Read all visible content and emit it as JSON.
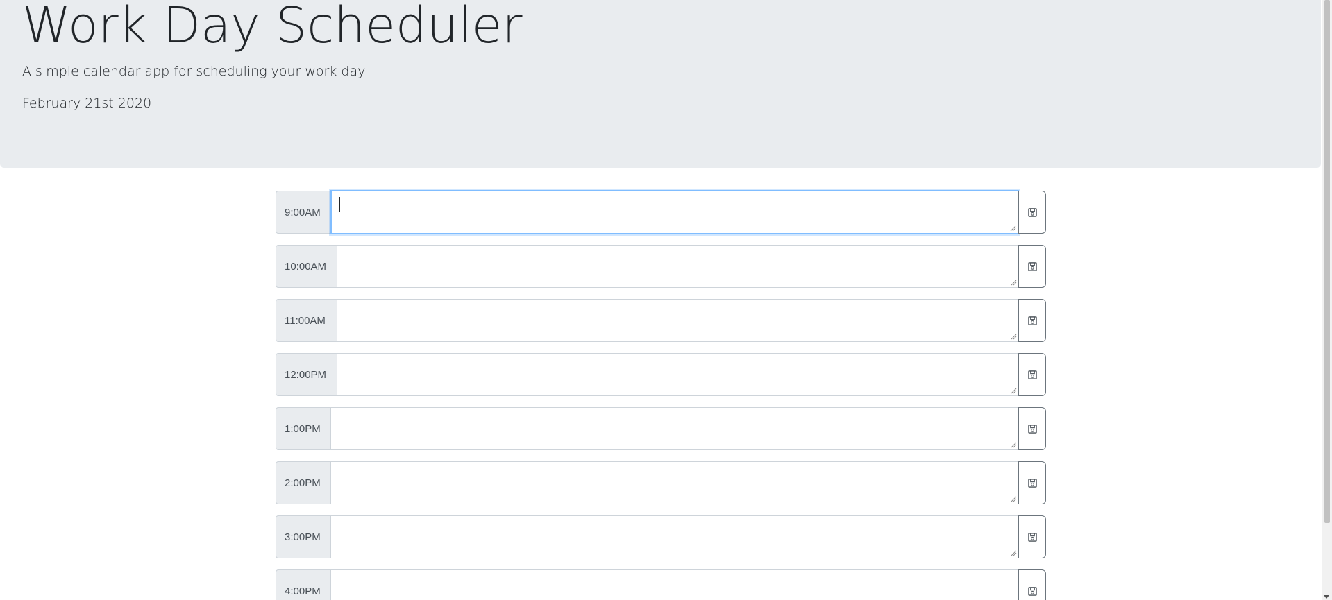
{
  "header": {
    "title": "Work Day Scheduler",
    "subtitle": "A simple calendar app for scheduling your work day",
    "current_date": "February 21st 2020"
  },
  "schedule": {
    "save_icon": "floppy-disk-icon",
    "rows": [
      {
        "hour": "9:00AM",
        "text": "",
        "focused": true
      },
      {
        "hour": "10:00AM",
        "text": ""
      },
      {
        "hour": "11:00AM",
        "text": ""
      },
      {
        "hour": "12:00PM",
        "text": ""
      },
      {
        "hour": "1:00PM",
        "text": ""
      },
      {
        "hour": "2:00PM",
        "text": ""
      },
      {
        "hour": "3:00PM",
        "text": ""
      },
      {
        "hour": "4:00PM",
        "text": ""
      }
    ]
  },
  "colors": {
    "jumbotron": "#e9ecef",
    "hour_bg": "#e9ecef",
    "focus_border": "#80bdff",
    "button_border": "#6c757d"
  }
}
